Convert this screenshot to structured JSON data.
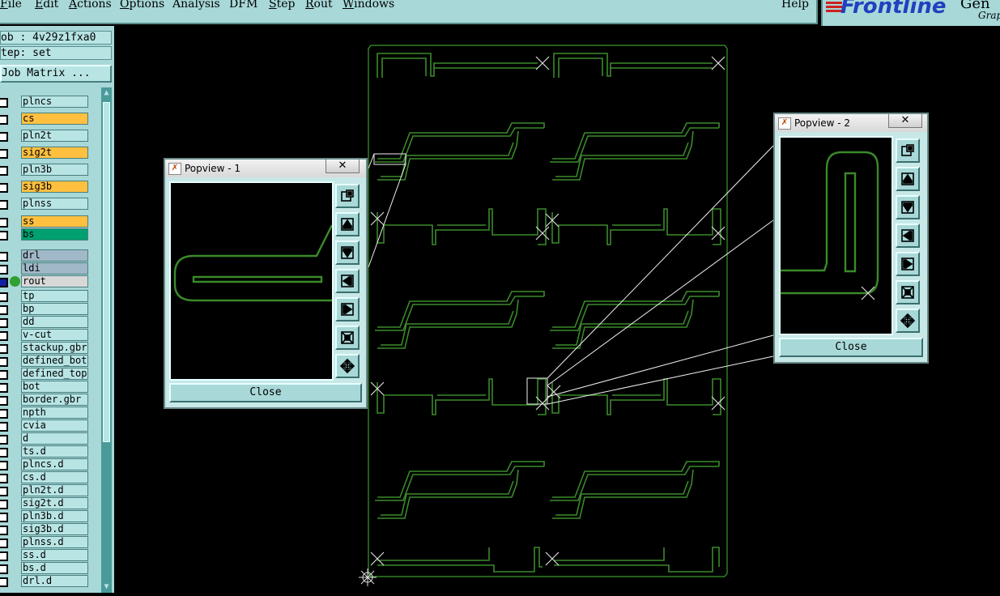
{
  "menu": {
    "items": [
      {
        "label": "File",
        "ul": "F",
        "rest": "ile"
      },
      {
        "label": "Edit",
        "ul": "E",
        "rest": "dit"
      },
      {
        "label": "Actions",
        "ul": "A",
        "rest": "ctions"
      },
      {
        "label": "Options",
        "ul": "O",
        "rest": "ptions"
      },
      {
        "label": "Analysis",
        "ul": "",
        "rest": "Analysis"
      },
      {
        "label": "DFM",
        "ul": "",
        "rest": "DFM"
      },
      {
        "label": "Step",
        "ul": "S",
        "rest": "tep"
      },
      {
        "label": "Rout",
        "ul": "R",
        "rest": "out"
      },
      {
        "label": "Windows",
        "ul": "W",
        "rest": "indows"
      },
      {
        "label": "Help",
        "ul": "",
        "rest": "Help"
      }
    ]
  },
  "logo": {
    "text": "Frontline",
    "sub": "Gen",
    "sub2": "Grap"
  },
  "job": {
    "job_label": "ob : 4v29z1fxa0",
    "step_label": "tep: set",
    "matrix_button": "Job Matrix ..."
  },
  "layers": [
    {
      "name": "plncs",
      "color": "#b8e4e4"
    },
    {
      "name": "cs",
      "color": "#ffc040"
    },
    {
      "name": "pln2t",
      "color": "#b8e4e4"
    },
    {
      "name": "sig2t",
      "color": "#ffc040"
    },
    {
      "name": "pln3b",
      "color": "#b8e4e4"
    },
    {
      "name": "sig3b",
      "color": "#ffc040"
    },
    {
      "name": "plnss",
      "color": "#b8e4e4"
    },
    {
      "name": "ss",
      "color": "#ffc040"
    },
    {
      "name": "bs",
      "color": "#00a070"
    },
    {
      "name": "drl",
      "color": "#a0b8c8"
    },
    {
      "name": "ldi",
      "color": "#a0b8c8"
    },
    {
      "name": "rout",
      "color": "#d8d8d8"
    },
    {
      "name": "tp",
      "color": "#b8e4e4"
    },
    {
      "name": "bp",
      "color": "#b8e4e4"
    },
    {
      "name": "dd",
      "color": "#b8e4e4"
    },
    {
      "name": "v-cut",
      "color": "#b8e4e4"
    },
    {
      "name": "stackup.gbr",
      "color": "#b8e4e4"
    },
    {
      "name": "defined_bott",
      "color": "#b8e4e4"
    },
    {
      "name": "defined_top",
      "color": "#b8e4e4"
    },
    {
      "name": "bot",
      "color": "#b8e4e4"
    },
    {
      "name": "border.gbr",
      "color": "#b8e4e4"
    },
    {
      "name": "npth",
      "color": "#b8e4e4"
    },
    {
      "name": "cvia",
      "color": "#b8e4e4"
    },
    {
      "name": "d",
      "color": "#b8e4e4"
    },
    {
      "name": "ts.d",
      "color": "#b8e4e4"
    },
    {
      "name": "plncs.d",
      "color": "#b8e4e4"
    },
    {
      "name": "cs.d",
      "color": "#b8e4e4"
    },
    {
      "name": "pln2t.d",
      "color": "#b8e4e4"
    },
    {
      "name": "sig2t.d",
      "color": "#b8e4e4"
    },
    {
      "name": "pln3b.d",
      "color": "#b8e4e4"
    },
    {
      "name": "sig3b.d",
      "color": "#b8e4e4"
    },
    {
      "name": "plnss.d",
      "color": "#b8e4e4"
    },
    {
      "name": "ss.d",
      "color": "#b8e4e4"
    },
    {
      "name": "bs.d",
      "color": "#b8e4e4"
    },
    {
      "name": "drl.d",
      "color": "#b8e4e4"
    }
  ],
  "popup1": {
    "title": "Popview - 1",
    "close_x": "✕",
    "close_label": "Close"
  },
  "popup2": {
    "title": "Popview - 2",
    "close_x": "✕",
    "close_label": "Close"
  },
  "popup_tools": [
    "zoom-fit-icon",
    "pan-up-icon",
    "pan-down-icon",
    "pan-left-icon",
    "pan-right-icon",
    "zoom-in-icon",
    "zoom-out-icon"
  ],
  "colors": {
    "panel": "#a8d8d8",
    "trace": "#3a8a2a",
    "background": "#000000",
    "active_layer": "#00a070",
    "signal_layer": "#ffc040"
  }
}
